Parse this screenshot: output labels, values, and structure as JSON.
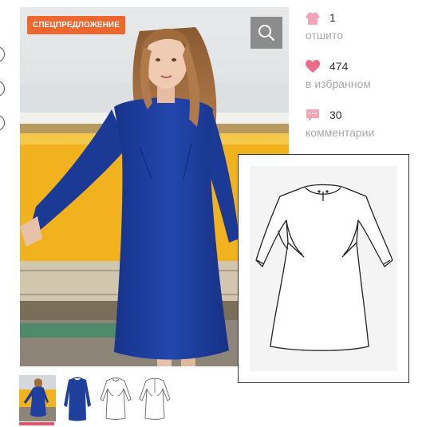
{
  "promo": {
    "badge": "СПЕЦПРЕДЛОЖЕНИЕ"
  },
  "zoom": {
    "icon": "search-icon"
  },
  "stats": [
    {
      "icon": "shirt-icon",
      "value": "1",
      "label": "отшито",
      "color": "#f4a6b8"
    },
    {
      "icon": "heart-icon",
      "value": "474",
      "label": "в избранном",
      "color": "#f06b8a"
    },
    {
      "icon": "comment-icon",
      "value": "30",
      "label": "комментарии",
      "color": "#f4a6b8"
    }
  ],
  "colors": {
    "accent": "#f0662f",
    "active_thumb": "#e8536b",
    "dress": "#1e3f9c"
  },
  "thumbnails": {
    "active_index": 0,
    "items": [
      "photo",
      "dress-front",
      "sketch-front",
      "sketch-back"
    ]
  }
}
